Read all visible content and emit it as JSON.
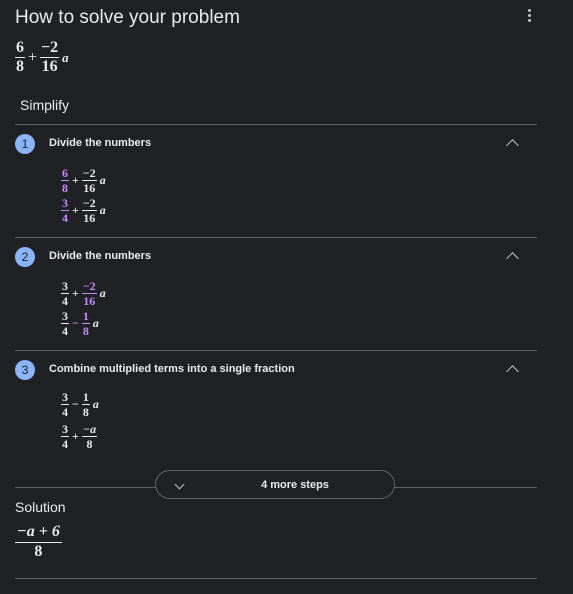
{
  "header": {
    "title": "How to solve your problem"
  },
  "problem": {
    "num1": "6",
    "den1": "8",
    "op": "+",
    "num2": "−2",
    "den2": "16",
    "var": "a"
  },
  "section": {
    "label": "Simplify"
  },
  "steps": [
    {
      "number": "1",
      "title": "Divide the numbers",
      "lines": [
        {
          "n1": "6",
          "d1": "8",
          "op": "+",
          "n2": "−2",
          "d2": "16",
          "var": "a"
        },
        {
          "n1": "3",
          "d1": "4",
          "op": "+",
          "n2": "−2",
          "d2": "16",
          "var": "a"
        }
      ]
    },
    {
      "number": "2",
      "title": "Divide the numbers",
      "lines": [
        {
          "n1": "3",
          "d1": "4",
          "op": "+",
          "n2": "−2",
          "d2": "16",
          "var": "a"
        },
        {
          "n1": "3",
          "d1": "4",
          "op": "−",
          "n2": "1",
          "d2": "8",
          "var": "a"
        }
      ]
    },
    {
      "number": "3",
      "title": "Combine multiplied terms into a single fraction",
      "lines": [
        {
          "n1": "3",
          "d1": "4",
          "op": "−",
          "n2": "1",
          "d2": "8",
          "var": "a"
        },
        {
          "n1": "3",
          "d1": "4",
          "op": "+",
          "n2": "−a",
          "d2": "8",
          "var": ""
        }
      ]
    }
  ],
  "more_steps": {
    "label": "4 more steps"
  },
  "solution": {
    "label": "Solution",
    "numerator": "−a + 6",
    "denominator": "8"
  },
  "colors": {
    "background": "#202124",
    "badge": "#8ab4f8",
    "highlight": "#c58af9",
    "divider": "#5f6368"
  },
  "icons": {
    "menu": "more-vert-icon",
    "collapse": "chevron-up-icon",
    "expand": "chevron-down-icon"
  }
}
